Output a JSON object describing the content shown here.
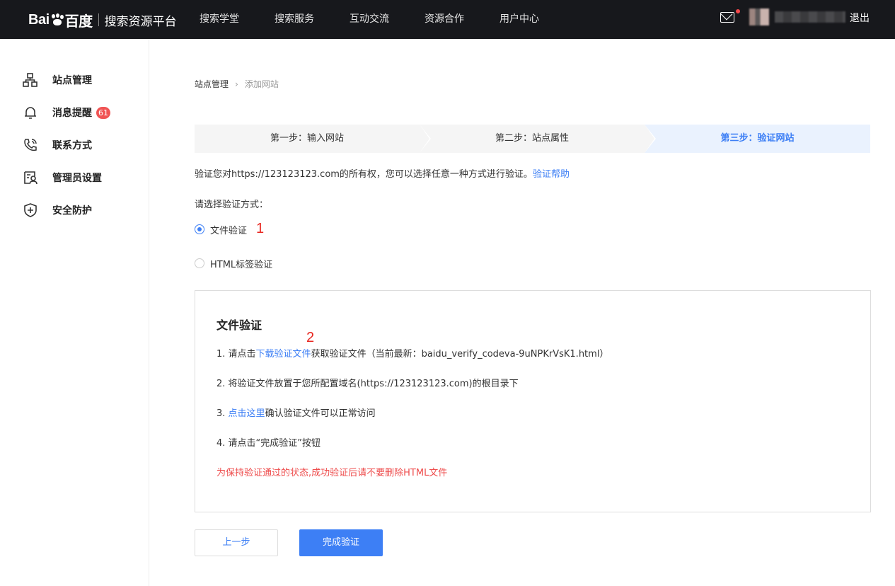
{
  "header": {
    "logo_text": "Bai",
    "logo_text_2": "百度",
    "platform_title": "搜索资源平台",
    "nav": [
      "搜索学堂",
      "搜索服务",
      "互动交流",
      "资源合作",
      "用户中心"
    ],
    "logout_label": "退出"
  },
  "sidebar": {
    "items": [
      {
        "label": "站点管理",
        "icon": "sitemap-icon"
      },
      {
        "label": "消息提醒",
        "icon": "bell-icon",
        "badge": "61"
      },
      {
        "label": "联系方式",
        "icon": "phone-icon"
      },
      {
        "label": "管理员设置",
        "icon": "admin-icon"
      },
      {
        "label": "安全防护",
        "icon": "shield-icon"
      }
    ]
  },
  "breadcrumb": {
    "parent": "站点管理",
    "current": "添加网站"
  },
  "steps": [
    {
      "label": "第一步：输入网站"
    },
    {
      "label": "第二步：站点属性"
    },
    {
      "label": "第三步：验证网站",
      "active": true
    }
  ],
  "verify": {
    "description": "验证您对https://123123123.com的所有权，您可以选择任意一种方式进行验证。",
    "help_link": "验证帮助",
    "choose_label": "请选择验证方式：",
    "options": [
      {
        "label": "文件验证",
        "checked": true
      },
      {
        "label": "HTML标签验证",
        "checked": false
      }
    ],
    "annotations": [
      "1",
      "2"
    ]
  },
  "panel": {
    "title": "文件验证",
    "step1_prefix": "1.  请点击",
    "step1_link": "下载验证文件",
    "step1_suffix": "获取验证文件（当前最新：baidu_verify_codeva-9uNPKrVsK1.html）",
    "step2": "2.  将验证文件放置于您所配置域名(https://123123123.com)的根目录下",
    "step3_prefix": "3.  ",
    "step3_link": "点击这里",
    "step3_suffix": "确认验证文件可以正常访问",
    "step4": "4.  请点击“完成验证”按钮",
    "warning": "为保持验证通过的状态,成功验证后请不要删除HTML文件"
  },
  "buttons": {
    "prev": "上一步",
    "done": "完成验证"
  },
  "colors": {
    "accent": "#3d7ff5",
    "topbar": "#17181c",
    "badge": "#f05454",
    "warning": "#ee4b4b",
    "annotation": "#e8261f"
  }
}
